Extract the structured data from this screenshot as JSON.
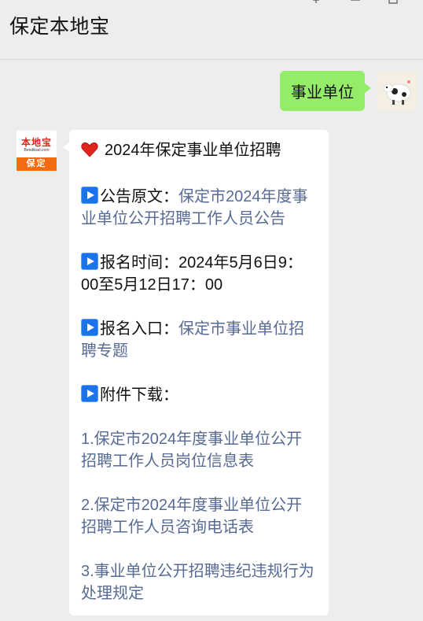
{
  "window": {
    "title": "保定本地宝"
  },
  "chat": {
    "user_message": "事业单位",
    "bot": {
      "avatar_logo": "本地宝",
      "avatar_logo_sub": "Bendibao.com",
      "avatar_city": "保定",
      "heading": "2024年保定事业单位招聘",
      "announcement_label": "公告原文：",
      "announcement_link": "保定市2024年度事业单位公开招聘工作人员公告",
      "time_label": "报名时间：",
      "time_value": "2024年5月6日9：00至5月12日17：00",
      "entry_label": "报名入口：",
      "entry_link": "保定市事业单位招聘专题",
      "attachments_label": "附件下载：",
      "attachments": [
        "1.保定市2024年度事业单位公开招聘工作人员岗位信息表",
        "2.保定市2024年度事业单位公开招聘工作人员咨询电话表",
        "3.事业单位公开招聘违纪违规行为处理规定"
      ]
    }
  },
  "colors": {
    "link": "#576b95",
    "outgoing_bubble": "#95ec69",
    "background": "#ededed"
  }
}
